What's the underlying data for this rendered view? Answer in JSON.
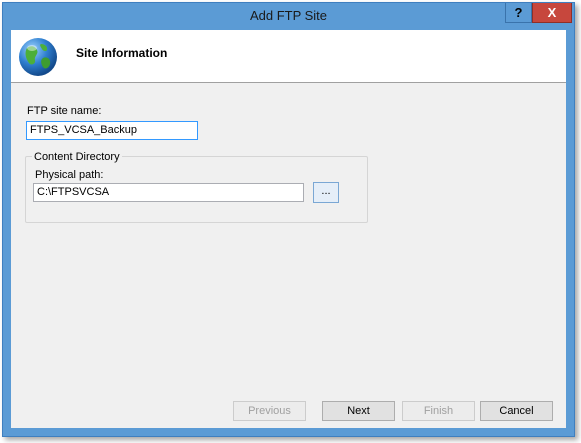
{
  "window": {
    "title": "Add FTP Site",
    "help_label": "?",
    "close_label": "X"
  },
  "header": {
    "title": "Site Information",
    "icon": "globe-icon"
  },
  "form": {
    "site_name_label": "FTP site name:",
    "site_name_value": "FTPS_VCSA_Backup",
    "content_directory_label": "Content Directory",
    "physical_path_label": "Physical path:",
    "physical_path_value": "C:\\FTPSVCSA",
    "browse_label": "..."
  },
  "buttons": {
    "previous": "Previous",
    "next": "Next",
    "finish": "Finish",
    "cancel": "Cancel"
  },
  "colors": {
    "frame": "#5b9bd5",
    "close": "#c7473d",
    "client": "#f0f0f0",
    "focus_border": "#3399ff"
  }
}
